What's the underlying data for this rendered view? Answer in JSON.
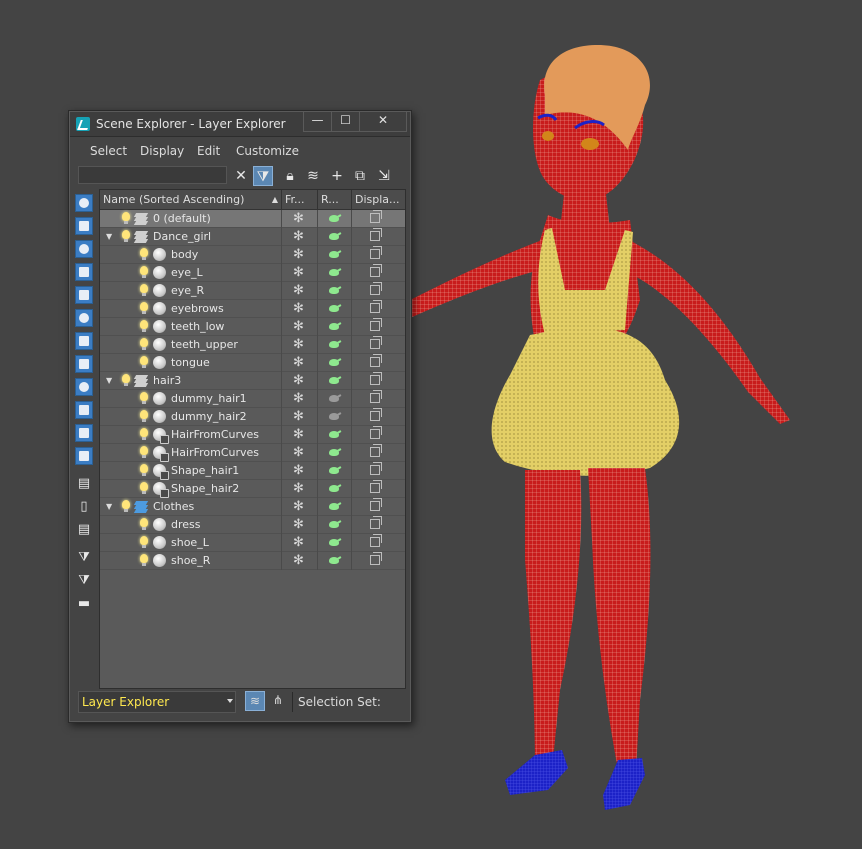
{
  "window": {
    "title": "Scene Explorer - Layer Explorer",
    "controls": {
      "minimize": "—",
      "maximize": "☐",
      "close": "✕"
    }
  },
  "menu": [
    "Select",
    "Display",
    "Edit",
    "Customize"
  ],
  "search": {
    "value": "",
    "placeholder": ""
  },
  "columns": {
    "name": "Name (Sorted Ascending)",
    "frozen": "Fr...",
    "render": "R...",
    "display": "Displa..."
  },
  "rows": [
    {
      "name": "0 (default)",
      "level": 0,
      "type": "layer",
      "expander": "",
      "selected": true
    },
    {
      "name": "Dance_girl",
      "level": 0,
      "type": "layer",
      "expander": "▼"
    },
    {
      "name": "body",
      "level": 1,
      "type": "object"
    },
    {
      "name": "eye_L",
      "level": 1,
      "type": "object"
    },
    {
      "name": "eye_R",
      "level": 1,
      "type": "object"
    },
    {
      "name": "eyebrows",
      "level": 1,
      "type": "object"
    },
    {
      "name": "teeth_low",
      "level": 1,
      "type": "object"
    },
    {
      "name": "teeth_upper",
      "level": 1,
      "type": "object"
    },
    {
      "name": "tongue",
      "level": 1,
      "type": "object"
    },
    {
      "name": "hair3",
      "level": 0,
      "type": "layer",
      "expander": "▼"
    },
    {
      "name": "dummy_hair1",
      "level": 1,
      "type": "object",
      "render_dim": true
    },
    {
      "name": "dummy_hair2",
      "level": 1,
      "type": "object",
      "render_dim": true
    },
    {
      "name": "HairFromCurves",
      "level": 1,
      "type": "hair"
    },
    {
      "name": "HairFromCurves",
      "level": 1,
      "type": "hair"
    },
    {
      "name": "Shape_hair1",
      "level": 1,
      "type": "hair"
    },
    {
      "name": "Shape_hair2",
      "level": 1,
      "type": "hair"
    },
    {
      "name": "Clothes",
      "level": 0,
      "type": "layer-blue",
      "expander": "▼"
    },
    {
      "name": "dress",
      "level": 1,
      "type": "object"
    },
    {
      "name": "shoe_L",
      "level": 1,
      "type": "object"
    },
    {
      "name": "shoe_R",
      "level": 1,
      "type": "object"
    }
  ],
  "statusbar": {
    "explorer": "Layer Explorer",
    "selection_label": "Selection Set:"
  },
  "colors": {
    "accent": "#5b87b3",
    "explorer_text": "#ffe94f",
    "mesh_body": "#c0191b",
    "dress": "#e8d36a",
    "hair": "#e39a5a",
    "shoes": "#1c22c7"
  },
  "icons": {
    "toolbar": [
      "clear-search-icon",
      "filter-icon",
      "lock-icon",
      "layer-highlight-icon",
      "add-icon",
      "add-to-layer-icon",
      "select-layer-icon"
    ],
    "side": [
      "display-geometry-icon",
      "display-shapes-icon",
      "display-lights-icon",
      "display-cameras-icon",
      "display-helpers-icon",
      "display-spacewarps-icon",
      "display-groups-icon",
      "display-xrefs-icon",
      "display-bones-icon",
      "display-containers-icon",
      "display-frozen-icon",
      "display-hidden-icon",
      "display-all-icon",
      "display-none-icon",
      "display-invert-icon",
      "filter-funnel-icon",
      "filter-settings-icon",
      "collapse-icon"
    ]
  }
}
